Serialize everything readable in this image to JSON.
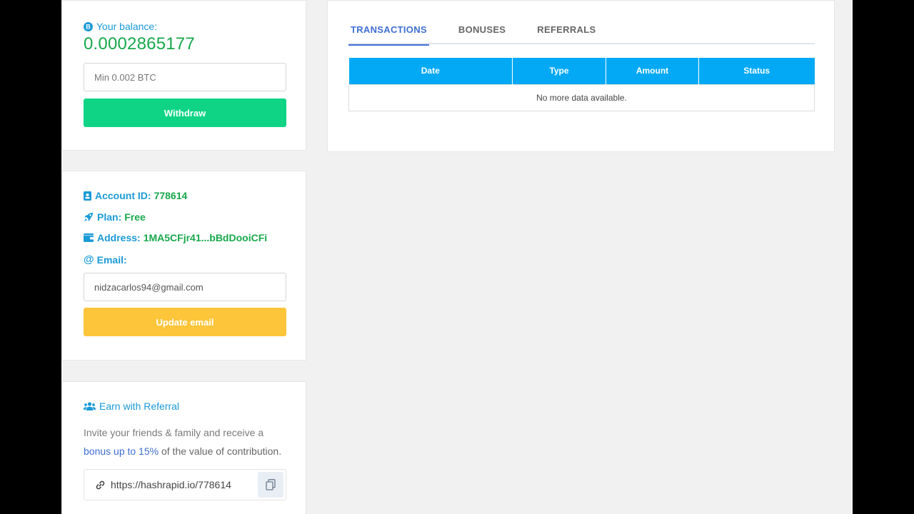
{
  "balance": {
    "label": "Your balance:",
    "value": "0.0002865177",
    "withdraw_placeholder": "Min 0.002 BTC",
    "withdraw_label": "Withdraw"
  },
  "account": {
    "id_label": "Account ID:",
    "id_value": "778614",
    "plan_label": "Plan:",
    "plan_value": "Free",
    "address_label": "Address:",
    "address_value": "1MA5CFjr41...bBdDooiCFi",
    "email_label": "Email:",
    "email_value": "nidzacarlos94@gmail.com",
    "update_email_label": "Update email"
  },
  "referral": {
    "title": "Earn with Referral",
    "desc_part1": "Invite your friends & family and receive a",
    "desc_highlight": "bonus up to 15%",
    "desc_part2": "of the value of contribution.",
    "link": "https://hashrapid.io/778614"
  },
  "tabs": [
    {
      "label": "TRANSACTIONS",
      "active": true
    },
    {
      "label": "BONUSES",
      "active": false
    },
    {
      "label": "REFERRALS",
      "active": false
    }
  ],
  "table": {
    "columns": [
      "Date",
      "Type",
      "Amount",
      "Status"
    ],
    "empty_message": "No more data available."
  },
  "icons": {
    "balance": "bitcoin-icon",
    "account": "id-card-icon",
    "plan": "rocket-icon",
    "address": "wallet-icon",
    "email": "at-icon",
    "referral": "users-icon",
    "link": "link-icon",
    "copy": "copy-icon"
  },
  "colors": {
    "accent_blue": "#1a9ad6",
    "value_green": "#17a84b",
    "withdraw_green": "#0fd485",
    "update_yellow": "#fcc53a",
    "table_header": "#03a9f4",
    "tab_active": "#3f6ed1"
  }
}
